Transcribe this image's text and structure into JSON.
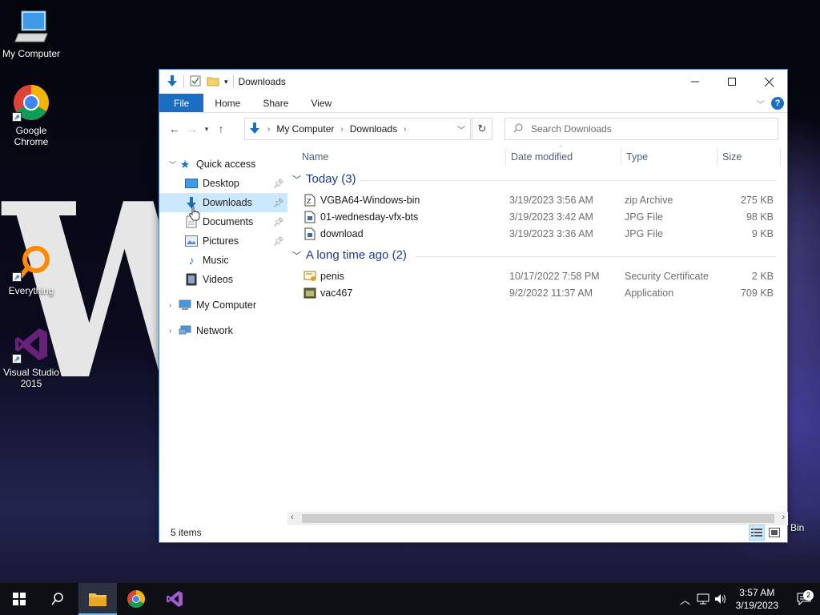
{
  "desktop": {
    "icons": [
      {
        "label": "My Computer"
      },
      {
        "label": "Google Chrome"
      },
      {
        "label": "Everything"
      },
      {
        "label": "Visual Studio 2015"
      }
    ],
    "bin_label": "Bin",
    "wallpaper_text": "WE"
  },
  "window": {
    "title": "Downloads",
    "ribbon_tabs": [
      "File",
      "Home",
      "Share",
      "View"
    ],
    "help_label": "?",
    "address": {
      "crumbs": [
        "My Computer",
        "Downloads"
      ]
    },
    "search": {
      "placeholder": "Search Downloads"
    },
    "nav": {
      "quick_access": "Quick access",
      "quick_items": [
        {
          "label": "Desktop",
          "pinned": true
        },
        {
          "label": "Downloads",
          "pinned": true,
          "selected": true
        },
        {
          "label": "Documents",
          "pinned": true
        },
        {
          "label": "Pictures",
          "pinned": true
        },
        {
          "label": "Music",
          "pinned": false
        },
        {
          "label": "Videos",
          "pinned": false
        }
      ],
      "my_computer": "My Computer",
      "network": "Network"
    },
    "columns": [
      "Name",
      "Date modified",
      "Type",
      "Size"
    ],
    "groups": [
      {
        "label": "Today (3)",
        "files": [
          {
            "name": "VGBA64-Windows-bin",
            "date": "3/19/2023 3:56 AM",
            "type": "zip Archive",
            "size": "275 KB",
            "icon": "zip-icon"
          },
          {
            "name": "01-wednesday-vfx-bts",
            "date": "3/19/2023 3:42 AM",
            "type": "JPG File",
            "size": "98 KB",
            "icon": "image-file-icon"
          },
          {
            "name": "download",
            "date": "3/19/2023 3:36 AM",
            "type": "JPG File",
            "size": "9 KB",
            "icon": "image-file-icon"
          }
        ]
      },
      {
        "label": "A long time ago (2)",
        "files": [
          {
            "name": "penis",
            "date": "10/17/2022 7:58 PM",
            "type": "Security Certificate",
            "size": "2 KB",
            "icon": "certificate-icon"
          },
          {
            "name": "vac467",
            "date": "9/2/2022 11:37 AM",
            "type": "Application",
            "size": "709 KB",
            "icon": "application-icon"
          }
        ]
      }
    ],
    "status": "5 items"
  },
  "taskbar": {
    "time": "3:57 AM",
    "date": "3/19/2023",
    "notification_count": "2"
  },
  "colors": {
    "accent": "#1a6fc4",
    "selection": "#cce8ff",
    "group_header": "#1e3a8a"
  }
}
